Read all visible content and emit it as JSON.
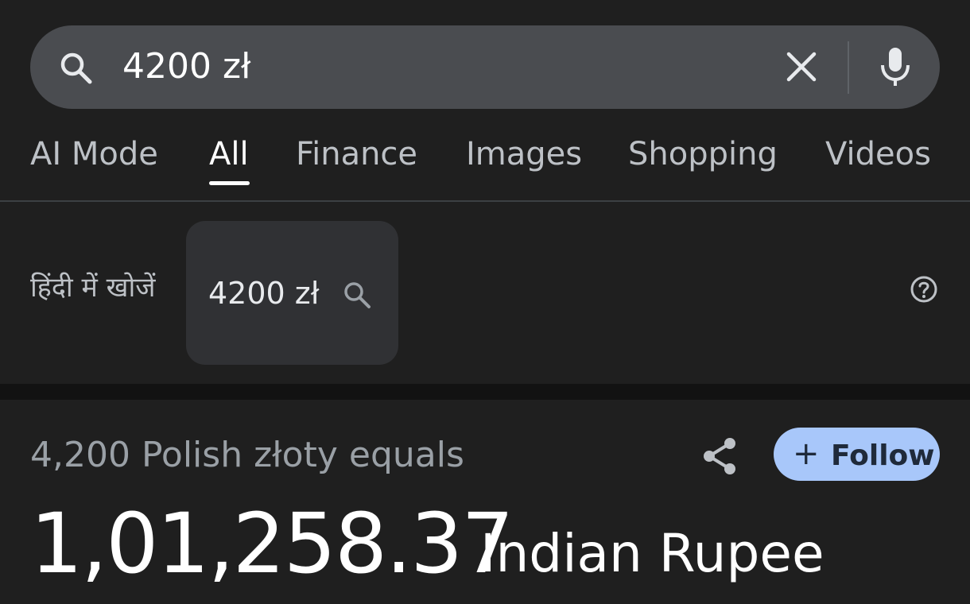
{
  "search": {
    "query": "4200 zł",
    "icons": {
      "search": "search-icon",
      "clear": "close-icon",
      "voice": "mic-icon"
    }
  },
  "tabs": [
    {
      "label": "AI Mode",
      "active": false
    },
    {
      "label": "All",
      "active": true
    },
    {
      "label": "Finance",
      "active": false
    },
    {
      "label": "Images",
      "active": false
    },
    {
      "label": "Shopping",
      "active": false
    },
    {
      "label": "Videos",
      "active": false
    }
  ],
  "suggestion": {
    "label": "हिंदी में खोजें",
    "chip_text": "4200 zł",
    "icons": {
      "chip": "search-icon",
      "help": "help-icon"
    }
  },
  "converter": {
    "equals_text": "4,200 Polish złoty equals",
    "result_value": "1,01,258.37",
    "result_unit": "Indian Rupee",
    "follow_plus": "+",
    "follow_label": "Follow",
    "icons": {
      "share": "share-icon"
    }
  },
  "colors": {
    "background": "#1f1f1f",
    "search_bar": "#4a4c50",
    "chip": "#303134",
    "follow_button": "#a8c7fa"
  }
}
